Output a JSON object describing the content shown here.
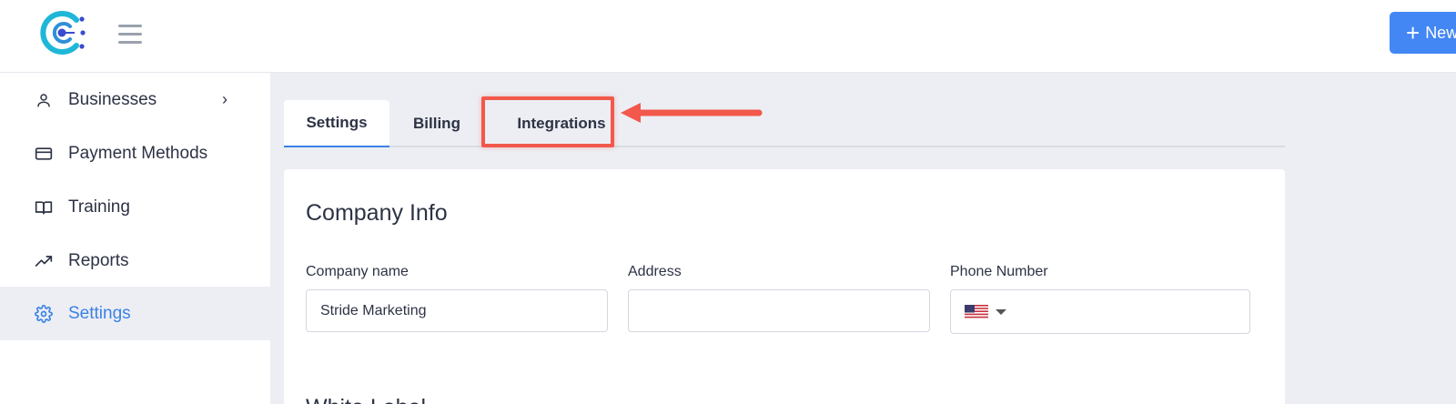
{
  "header": {
    "logo_icon": "logo-icon",
    "menu_icon": "hamburger-icon",
    "new_button": {
      "icon": "plus-icon",
      "plus": "+",
      "label": "New"
    }
  },
  "sidebar": {
    "items": [
      {
        "label": "Businesses",
        "icon": "user-icon",
        "chevron": "›"
      },
      {
        "label": "Payment Methods",
        "icon": "credit-card-icon"
      },
      {
        "label": "Training",
        "icon": "book-icon"
      },
      {
        "label": "Reports",
        "icon": "trending-up-icon"
      },
      {
        "label": "Settings",
        "icon": "gear-icon",
        "active": true
      }
    ]
  },
  "main": {
    "tabs": [
      {
        "label": "Settings",
        "active": true
      },
      {
        "label": "Billing"
      },
      {
        "label": "Integrations",
        "highlighted": true
      }
    ],
    "company_info": {
      "title": "Company Info",
      "fields": {
        "company_name": {
          "label": "Company name",
          "value": "Stride Marketing"
        },
        "address": {
          "label": "Address",
          "value": ""
        },
        "phone": {
          "label": "Phone Number",
          "value": "",
          "flag_icon": "us-flag-icon"
        }
      }
    },
    "white_label": {
      "title": "White Label"
    }
  },
  "colors": {
    "accent": "#3b82e6",
    "button": "#4387f4",
    "annotation": "#f2584b",
    "main_bg": "#eceef3"
  }
}
